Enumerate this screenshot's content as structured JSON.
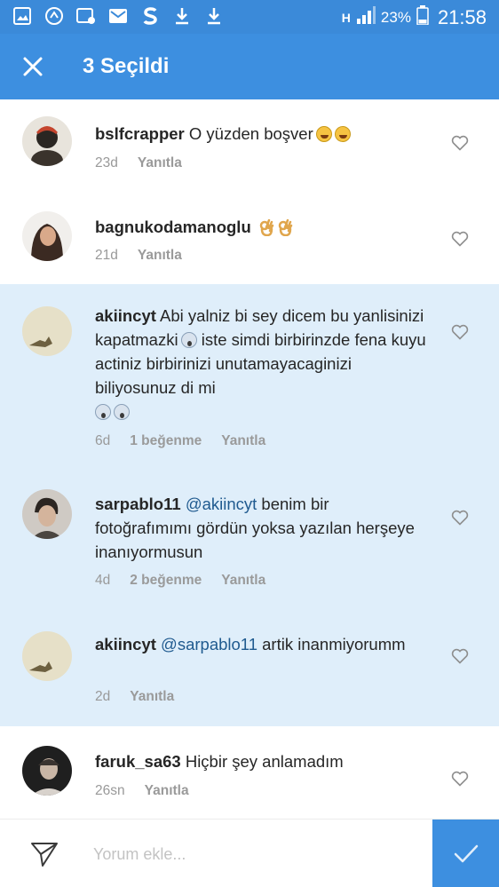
{
  "status_bar": {
    "network": "H",
    "battery": "23%",
    "time": "21:58"
  },
  "app_bar": {
    "title": "3 Seçildi"
  },
  "comments": [
    {
      "username": "bslfcrapper",
      "text": "O yüzden boşver",
      "time": "23d",
      "reply": "Yanıtla",
      "likes": "",
      "selected": false
    },
    {
      "username": "bagnukodamanoglu",
      "text": "",
      "time": "21d",
      "reply": "Yanıtla",
      "likes": "",
      "selected": false
    },
    {
      "username": "akiincyt",
      "text_a": "Abi yalniz bi sey dicem bu yanlisinizi kapatmazki",
      "text_b": "iste simdi birbirinzde fena kuyu actiniz birbirinizi unutamayacaginizi biliyosunuz di mi",
      "time": "6d",
      "likes": "1 beğenme",
      "reply": "Yanıtla",
      "selected": true
    },
    {
      "username": "sarpablo11",
      "mention": "@akiincyt",
      "text": "benim bir fotoğrafımımı gördün yoksa yazılan herşeye inanıyormusun",
      "time": "4d",
      "likes": "2 beğenme",
      "reply": "Yanıtla",
      "selected": true
    },
    {
      "username": "akiincyt",
      "mention": "@sarpablo11",
      "text": "artik inanmiyorumm",
      "time": "2d",
      "reply": "Yanıtla",
      "selected": true
    },
    {
      "username": "faruk_sa63",
      "text": "Hiçbir şey anlamadım",
      "time": "26sn",
      "reply": "Yanıtla",
      "selected": false
    }
  ],
  "input": {
    "placeholder": "Yorum ekle..."
  },
  "colors": {
    "app_bar": "#3d8fe0",
    "status_bar": "#3b8ad9",
    "selected_row": "#dfeefa",
    "mention": "#1f5a8f"
  }
}
